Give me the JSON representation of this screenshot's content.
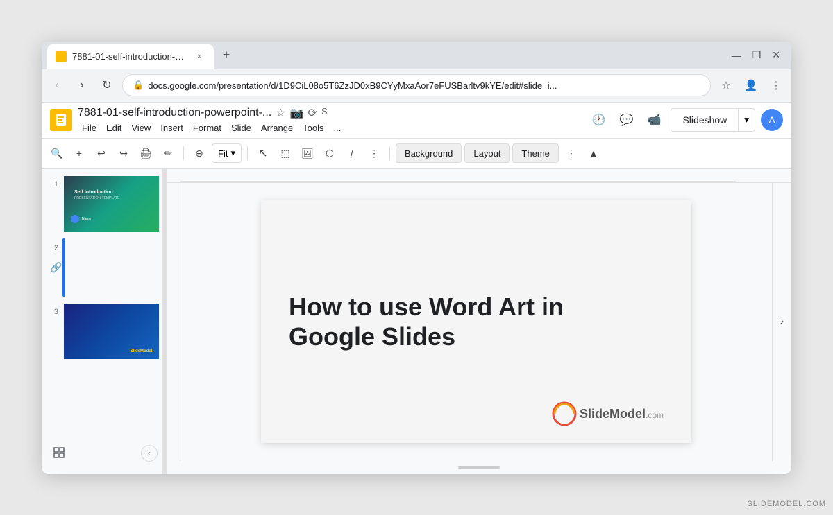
{
  "window": {
    "title": "7881-01-self-introduction-powe...",
    "tab_close": "×",
    "new_tab": "+",
    "controls": [
      "—",
      "❐",
      "✕"
    ]
  },
  "address_bar": {
    "url": "docs.google.com/presentation/d/1D9CiL08o5T6ZzJD0xB9CYyMxaAor7eFUSBarltv9kYE/edit#slide=i...",
    "back": "‹",
    "forward": "›",
    "reload": "↻"
  },
  "app": {
    "title": "7881-01-self-introduction-powerpoint-...",
    "menu": [
      "File",
      "Edit",
      "View",
      "Insert",
      "Format",
      "Slide",
      "Arrange",
      "Tools",
      "..."
    ],
    "slideshow_label": "Slideshow",
    "avatar_initials": "A"
  },
  "toolbar": {
    "zoom": "Fit",
    "buttons": [
      "Background",
      "Layout",
      "Theme"
    ]
  },
  "slides": [
    {
      "number": "1",
      "active": false,
      "type": "intro"
    },
    {
      "number": "2",
      "active": true,
      "type": "wordart"
    },
    {
      "number": "3",
      "active": false,
      "type": "dark"
    }
  ],
  "main_slide": {
    "title": "How to use Word Art in Google Slides",
    "logo_text": "SlideModel",
    "logo_suffix": ".com"
  },
  "watermark": "SLIDEMODEL.COM"
}
